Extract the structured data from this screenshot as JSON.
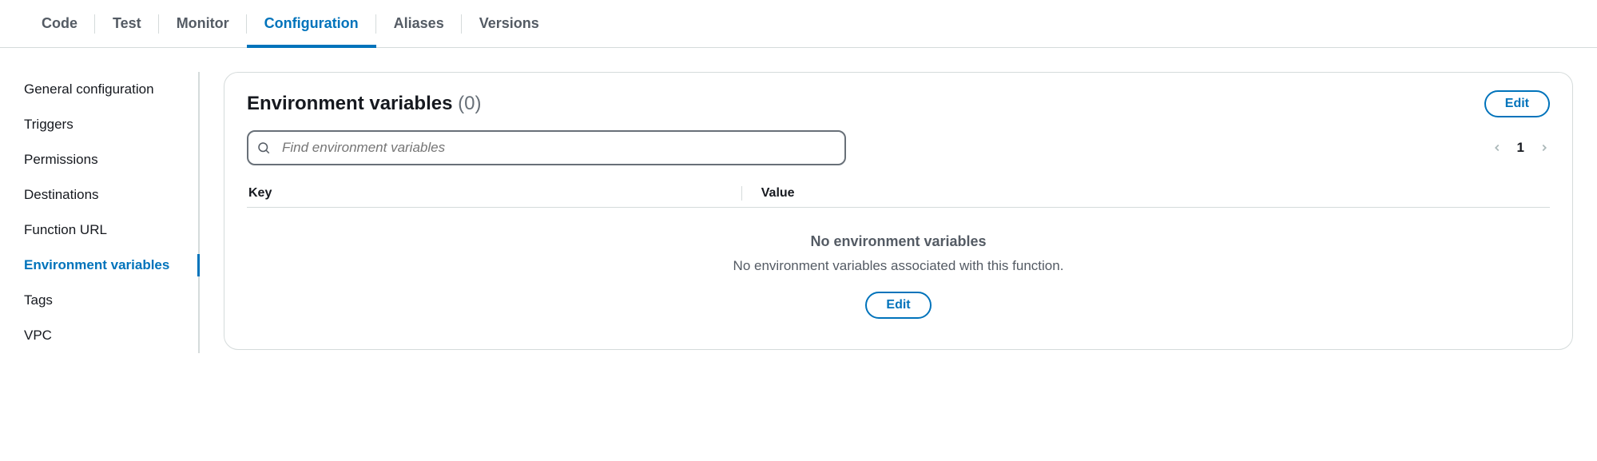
{
  "tabs": [
    {
      "label": "Code"
    },
    {
      "label": "Test"
    },
    {
      "label": "Monitor"
    },
    {
      "label": "Configuration"
    },
    {
      "label": "Aliases"
    },
    {
      "label": "Versions"
    }
  ],
  "active_tab_index": 3,
  "sidebar": {
    "items": [
      {
        "label": "General configuration"
      },
      {
        "label": "Triggers"
      },
      {
        "label": "Permissions"
      },
      {
        "label": "Destinations"
      },
      {
        "label": "Function URL"
      },
      {
        "label": "Environment variables"
      },
      {
        "label": "Tags"
      },
      {
        "label": "VPC"
      }
    ],
    "active_index": 5
  },
  "panel": {
    "title": "Environment variables",
    "count": "(0)",
    "edit_label": "Edit",
    "search_placeholder": "Find environment variables",
    "page_number": "1",
    "columns": {
      "key": "Key",
      "value": "Value"
    },
    "empty": {
      "title": "No environment variables",
      "subtitle": "No environment variables associated with this function.",
      "edit_label": "Edit"
    }
  }
}
